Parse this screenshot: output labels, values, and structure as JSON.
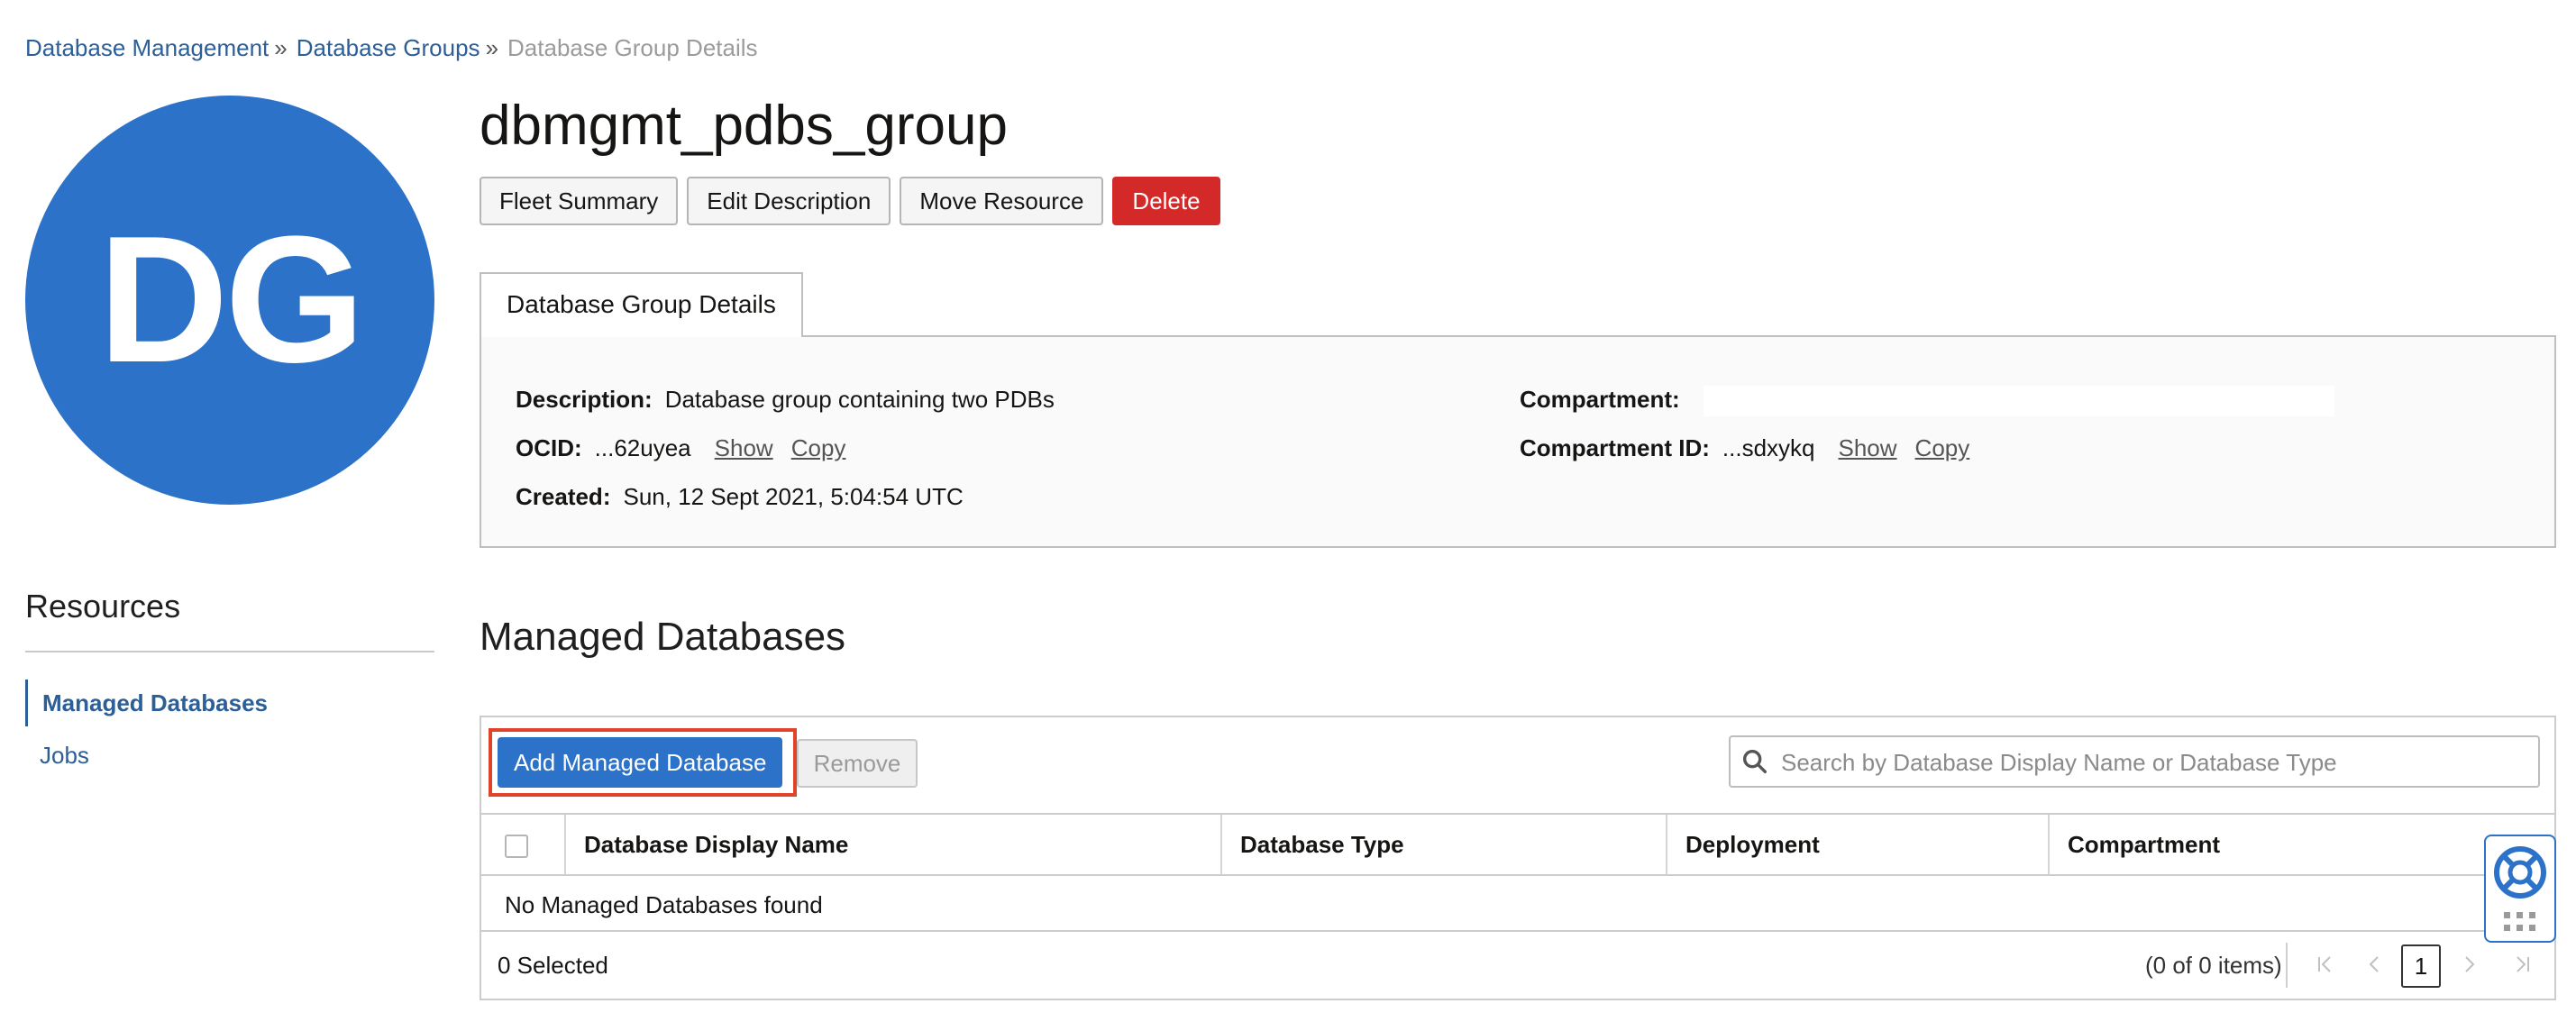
{
  "breadcrumb": {
    "items": [
      "Database Management",
      "Database Groups"
    ],
    "separator": "»",
    "current": "Database Group Details"
  },
  "avatar": {
    "initials": "DG",
    "color": "#2c72c8"
  },
  "resources": {
    "title": "Resources",
    "items": [
      {
        "label": "Managed Databases",
        "active": true
      },
      {
        "label": "Jobs",
        "active": false
      }
    ]
  },
  "header": {
    "title": "dbmgmt_pdbs_group",
    "buttons": {
      "fleet_summary": "Fleet Summary",
      "edit_description": "Edit Description",
      "move_resource": "Move Resource",
      "delete": "Delete"
    }
  },
  "details": {
    "tab_label": "Database Group Details",
    "description_label": "Description:",
    "description_value": "Database group containing two PDBs",
    "ocid_label": "OCID:",
    "ocid_value": "...62uyea",
    "created_label": "Created:",
    "created_value": "Sun, 12 Sept 2021, 5:04:54 UTC",
    "compartment_label": "Compartment:",
    "compartment_id_label": "Compartment ID:",
    "compartment_id_value": "...sdxykq",
    "show_link": "Show",
    "copy_link": "Copy"
  },
  "managed_databases": {
    "title": "Managed Databases",
    "add_button": "Add Managed Database",
    "remove_button": "Remove",
    "search_placeholder": "Search by Database Display Name or Database Type",
    "columns": [
      "Database Display Name",
      "Database Type",
      "Deployment",
      "Compartment"
    ],
    "empty_message": "No Managed Databases found",
    "selected_text": "0 Selected",
    "items_count": "(0 of 0 items)",
    "current_page": "1"
  },
  "colors": {
    "accent": "#2c72c8",
    "link": "#2c5e97",
    "danger": "#d42929",
    "highlight": "#e04428"
  }
}
